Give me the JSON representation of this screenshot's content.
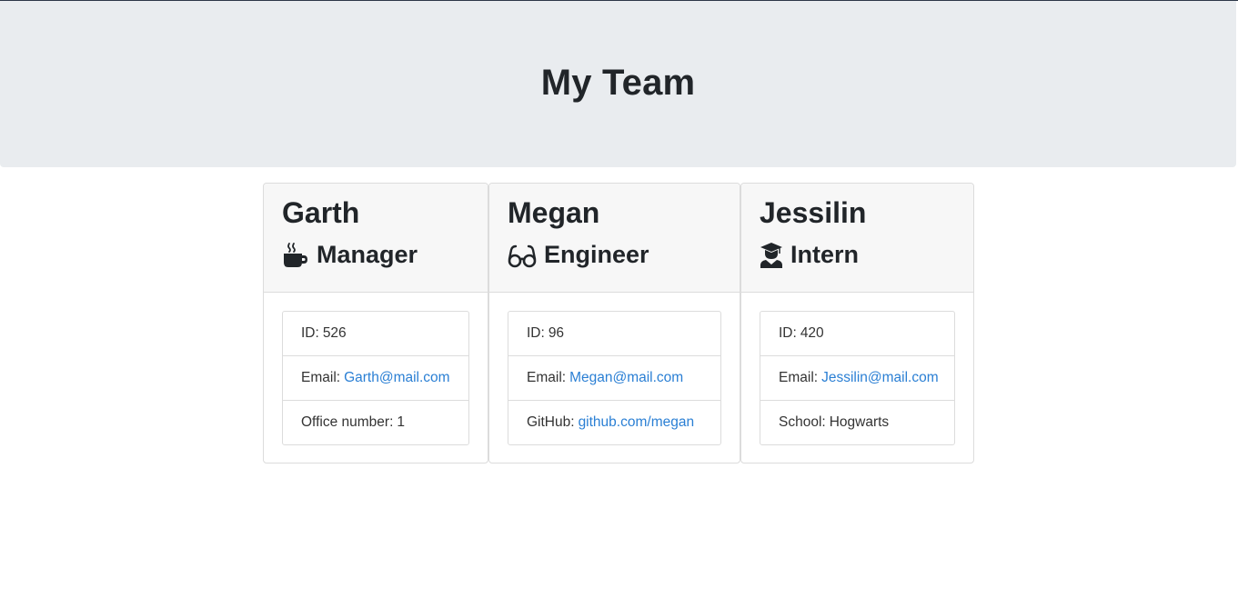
{
  "header": {
    "title": "My Team"
  },
  "team": [
    {
      "name": "Garth",
      "role": "Manager",
      "role_icon": "mug-hot-icon",
      "id_label": "ID:",
      "id": "526",
      "email_label": "Email:",
      "email": "Garth@mail.com",
      "extra_label": "Office number:",
      "extra_value": "1"
    },
    {
      "name": "Megan",
      "role": "Engineer",
      "role_icon": "glasses-icon",
      "id_label": "ID:",
      "id": "96",
      "email_label": "Email:",
      "email": "Megan@mail.com",
      "extra_label": "GitHub:",
      "extra_value": "github.com/megan"
    },
    {
      "name": "Jessilin",
      "role": "Intern",
      "role_icon": "user-graduate-icon",
      "id_label": "ID:",
      "id": "420",
      "email_label": "Email:",
      "email": "Jessilin@mail.com",
      "extra_label": "School:",
      "extra_value": "Hogwarts"
    }
  ],
  "colors": {
    "header_bg": "#e9ecef",
    "card_header_bg": "#f7f7f7",
    "link": "#2a7fd4",
    "text": "#212529"
  }
}
